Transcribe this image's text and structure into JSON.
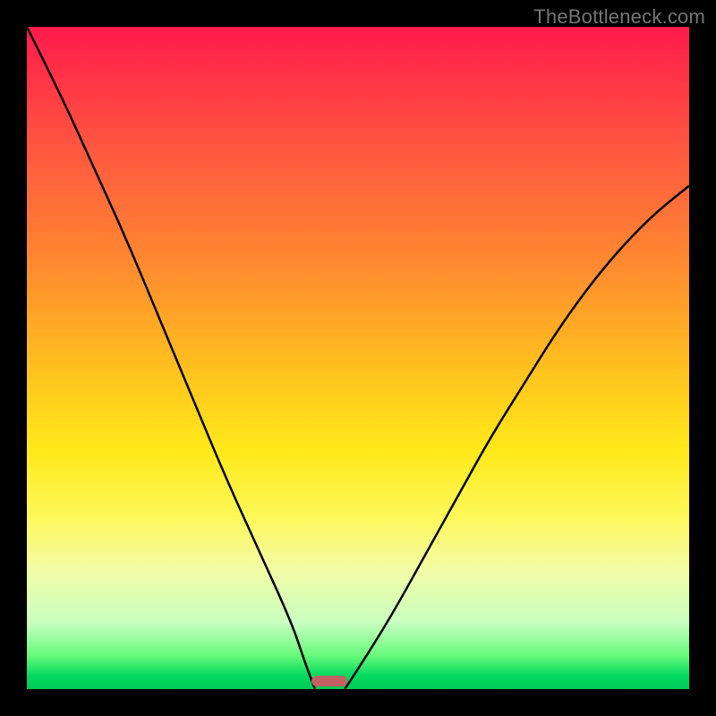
{
  "watermark": "TheBottleneck.com",
  "chart_data": {
    "type": "line",
    "title": "",
    "xlabel": "",
    "ylabel": "",
    "xlim": [
      0,
      100
    ],
    "ylim": [
      0,
      100
    ],
    "grid": false,
    "series": [
      {
        "name": "left-curve",
        "x": [
          0,
          5,
          10,
          15,
          20,
          25,
          30,
          35,
          40,
          42,
          43.5
        ],
        "values": [
          100,
          90,
          79,
          68,
          56,
          44,
          32,
          21,
          10,
          4,
          0
        ]
      },
      {
        "name": "right-curve",
        "x": [
          48,
          50,
          55,
          60,
          65,
          70,
          75,
          80,
          85,
          90,
          95,
          100
        ],
        "values": [
          0,
          3,
          11,
          20,
          29,
          38,
          46,
          54,
          61,
          67,
          72,
          76
        ]
      }
    ],
    "marker": {
      "x": 45.7,
      "color": "#c36162"
    },
    "background_gradient": {
      "top": "#ff1a4b",
      "mid": "#ffe91a",
      "bottom": "#00c957"
    }
  }
}
